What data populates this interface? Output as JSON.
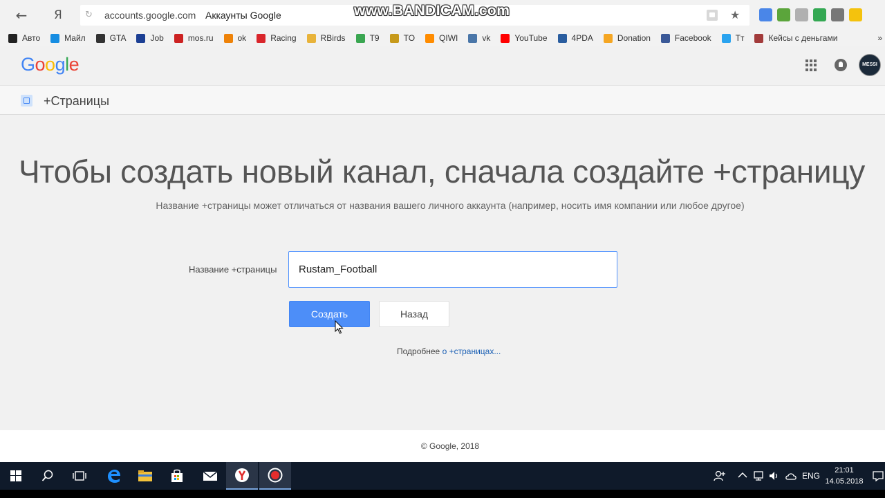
{
  "browser": {
    "back_icon": "arrow-left-icon",
    "yandex_label": "Я",
    "url_domain": "accounts.google.com",
    "page_title": "Аккаунты Google",
    "watermark": "www.BANDICAM.com",
    "extension_colors": [
      "#4a86e8",
      "#5ba53b",
      "#b0b0b0",
      "#34a853",
      "#777777",
      "#f4c20d"
    ]
  },
  "bookmarks": [
    {
      "label": "Авто",
      "color": "#222222"
    },
    {
      "label": "Майл",
      "color": "#168de2"
    },
    {
      "label": "GTA",
      "color": "#333333"
    },
    {
      "label": "Job",
      "color": "#1c3f94"
    },
    {
      "label": "mos.ru",
      "color": "#cc2222"
    },
    {
      "label": "ok",
      "color": "#ee8208"
    },
    {
      "label": "Racing",
      "color": "#d9252b"
    },
    {
      "label": "RBirds",
      "color": "#e8b33a"
    },
    {
      "label": "T9",
      "color": "#3aa651"
    },
    {
      "label": "TO",
      "color": "#c79a1b"
    },
    {
      "label": "QIWI",
      "color": "#ff8c00"
    },
    {
      "label": "vk",
      "color": "#4a76a8"
    },
    {
      "label": "YouTube",
      "color": "#ff0000"
    },
    {
      "label": "4PDA",
      "color": "#2a5d9f"
    },
    {
      "label": "Donation",
      "color": "#f5a623"
    },
    {
      "label": "Facebook",
      "color": "#3b5998"
    },
    {
      "label": "Тт",
      "color": "#2aa3ef"
    },
    {
      "label": "Кейсы с деньгами",
      "color": "#a23b3b"
    }
  ],
  "bookmarks_more": "»",
  "google": {
    "logo_letters": [
      {
        "ch": "G",
        "color": "#4285f4"
      },
      {
        "ch": "o",
        "color": "#ea4335"
      },
      {
        "ch": "o",
        "color": "#fbbc05"
      },
      {
        "ch": "g",
        "color": "#4285f4"
      },
      {
        "ch": "l",
        "color": "#34a853"
      },
      {
        "ch": "e",
        "color": "#ea4335"
      }
    ],
    "avatar_text": "MESSI",
    "section_title": "+Страницы"
  },
  "main": {
    "headline": "Чтобы создать новый канал, сначала создайте +страницу",
    "subline": "Название +страницы может отличаться от названия вашего личного аккаунта (например, носить имя компании или любое другое)",
    "field_label": "Название +страницы",
    "field_value": "Rustam_Football",
    "create_label": "Создать",
    "back_label": "Назад",
    "learn_prefix": "Подробнее",
    "learn_link": "о +страницах..."
  },
  "footer": {
    "copyright": "© Google, 2018"
  },
  "taskbar": {
    "lang": "ENG",
    "time": "21:01",
    "date": "14.05.2018"
  }
}
